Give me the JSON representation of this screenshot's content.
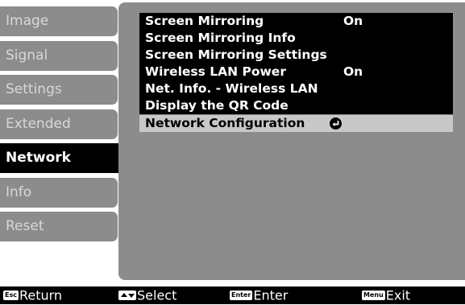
{
  "sidebar": {
    "items": [
      {
        "label": "Image",
        "selected": false
      },
      {
        "label": "Signal",
        "selected": false
      },
      {
        "label": "Settings",
        "selected": false
      },
      {
        "label": "Extended",
        "selected": false
      },
      {
        "label": "Network",
        "selected": true
      },
      {
        "label": "Info",
        "selected": false
      },
      {
        "label": "Reset",
        "selected": false
      }
    ]
  },
  "menu": {
    "rows": [
      {
        "label": "Screen Mirroring",
        "value": "On"
      },
      {
        "label": "Screen Mirroring Info",
        "value": ""
      },
      {
        "label": "Screen Mirroring Settings",
        "value": ""
      },
      {
        "label": "Wireless LAN Power",
        "value": "On"
      },
      {
        "label": "Net. Info. - Wireless LAN",
        "value": ""
      },
      {
        "label": "Display the QR Code",
        "value": ""
      },
      {
        "label": "Network Configuration",
        "value": "",
        "selected": true,
        "icon": "enter-icon"
      }
    ]
  },
  "help_bar": {
    "return": {
      "key": "Esc",
      "label": "Return"
    },
    "select": {
      "key_icon": "up-down-arrows-icon",
      "label": "Select"
    },
    "enter": {
      "key": "Enter",
      "label": "Enter"
    },
    "exit": {
      "key": "Menu",
      "label": "Exit"
    }
  },
  "colors": {
    "panel": "#8c8c8c",
    "row": "#000000",
    "selected_row": "#c8c8c8",
    "text": "#ffffff"
  }
}
